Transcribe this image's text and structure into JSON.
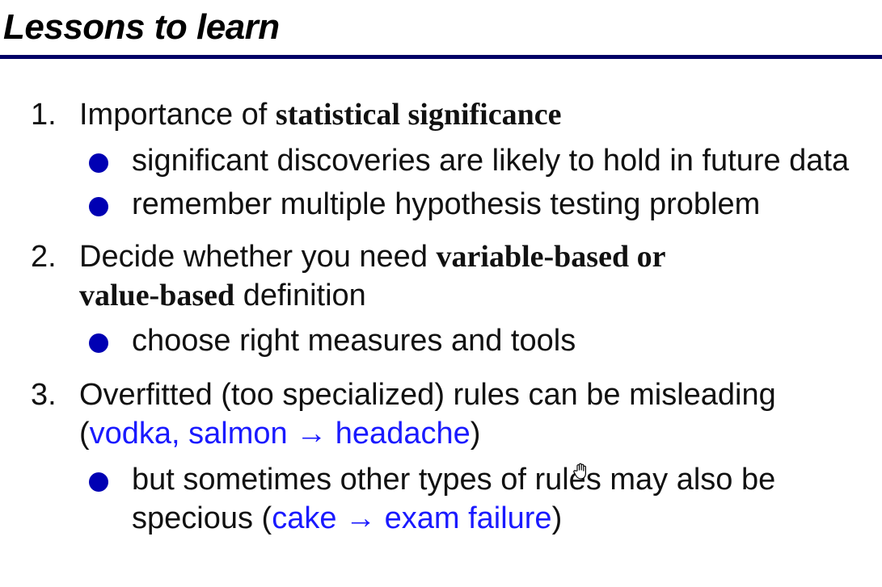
{
  "slide": {
    "title": "Lessons to learn"
  },
  "items": [
    {
      "number": "1.",
      "text_plain": "Importance of ",
      "text_bold": "statistical significance",
      "subs": [
        {
          "text": "significant discoveries are likely to hold in future data"
        },
        {
          "text": "remember multiple hypothesis testing problem"
        }
      ]
    },
    {
      "number": "2.",
      "text_plain": "Decide whether you need ",
      "text_bold_1": "variable-based or",
      "text_bold_2": "value-based",
      "text_plain_2": " definition",
      "subs": [
        {
          "text": "choose right measures and tools"
        }
      ]
    },
    {
      "number": "3.",
      "text_plain": "Overfitted (too specialized) rules can be misleading",
      "paren_open": "(",
      "example_rule": "vodka, salmon → headache",
      "paren_close": ")",
      "subs": [
        {
          "text_plain": "but sometimes other types of rules may also be specious (",
          "example_rule": "cake → exam failure",
          "text_close": ")"
        }
      ]
    }
  ],
  "colors": {
    "rule": "#000066",
    "bullet": "#0000b3",
    "example": "#1a1aff"
  },
  "icons": {
    "cursor": "hand-cursor-icon"
  }
}
